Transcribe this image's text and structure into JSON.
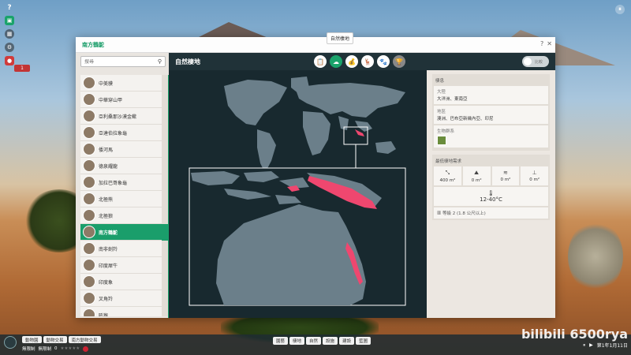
{
  "hud": {
    "help": "?",
    "counter": "1"
  },
  "window": {
    "title": "南方鶴鴕",
    "tooltip": "自然棲地"
  },
  "search": {
    "placeholder": "搜尋"
  },
  "animal_list": [
    {
      "name": "中美貘",
      "selected": false
    },
    {
      "name": "中華穿山甲",
      "selected": false
    },
    {
      "name": "亞利桑那沙漠金蠍",
      "selected": false
    },
    {
      "name": "亞達伯拉象龜",
      "selected": false
    },
    {
      "name": "倭河馬",
      "selected": false
    },
    {
      "name": "德泉耀龍",
      "selected": false
    },
    {
      "name": "加拉巴哥象龜",
      "selected": false
    },
    {
      "name": "北極熊",
      "selected": false
    },
    {
      "name": "北極狼",
      "selected": false
    },
    {
      "name": "南方鶴鴕",
      "selected": true
    },
    {
      "name": "南非劍羚",
      "selected": false
    },
    {
      "name": "印度犀牛",
      "selected": false
    },
    {
      "name": "印度象",
      "selected": false
    },
    {
      "name": "叉角羚",
      "selected": false
    },
    {
      "name": "吼猴",
      "selected": false
    }
  ],
  "map": {
    "title": "自然棲地",
    "tabs": [
      "📋",
      "☁",
      "💰",
      "🦌",
      "🐾",
      "🏆"
    ]
  },
  "info": {
    "toggle_label": "比較",
    "habitat_section_title": "棲息",
    "continent_key": "大陸",
    "continent_value": "大洋洲、東南亞",
    "region_key": "地區",
    "region_value": "澳洲、巴布亞新幾內亞、印尼",
    "biome_key": "生物群系",
    "req_section_title": "最低棲地需求",
    "land_area": "400 m²",
    "climb_area": "0 m²",
    "water_area": "0 m²",
    "deep_water_area": "0 m²",
    "temperature": "12-40°C",
    "fence": "等級 2 (1.8 公尺以上)"
  },
  "bottom": {
    "tabs": [
      "動物園",
      "動物交易",
      "南方動物交易"
    ],
    "stat1": "無限制",
    "stat2": "無限制",
    "stat3": "0",
    "center_tabs": [
      "園藝",
      "棲地",
      "自然",
      "設施",
      "建設",
      "藍圖"
    ],
    "date": "第1年1月11日",
    "watermark": "bilibili 6500rya"
  },
  "colors": {
    "accent": "#1aa36b",
    "range": "#ef476f",
    "map_bg": "#18292f",
    "land": "#6b7f8a"
  }
}
